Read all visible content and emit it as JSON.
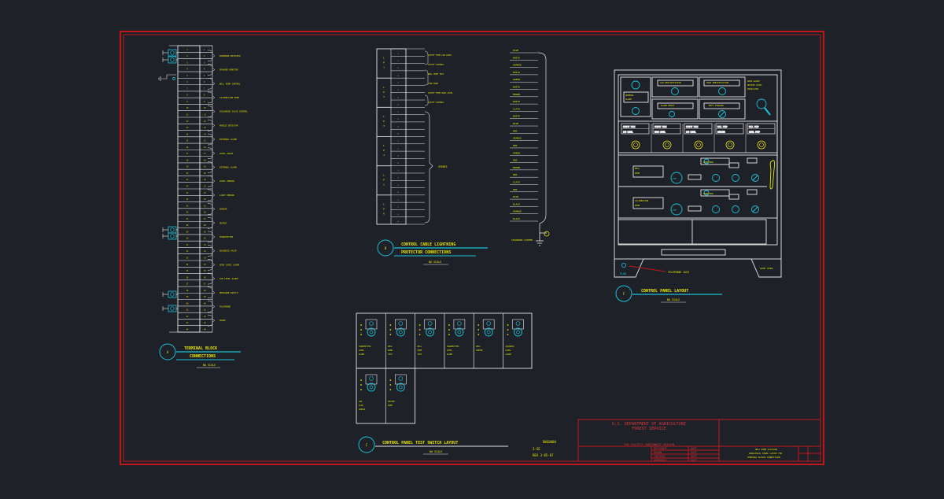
{
  "colors": {
    "background": "#1f2128",
    "border": "#c0161b",
    "linework": "#e8e8e8",
    "text": "#e6e600",
    "accent": "#19c3d8",
    "titleblock_text": "#d23a3a"
  },
  "terminal_block": {
    "circle_label": "A",
    "title": "TERMINAL BLOCK",
    "subtitle": "CONNECTIONS",
    "scale": "NO SCALE",
    "groups": [
      "WIDEBAND RECEIVER",
      "SPEAKER MONITOR",
      "WELL PUMP CONTROL",
      "CALIBRATION PUMP",
      "DISCHARGE VALVE CONTROL",
      "FREEZE DETECTOR",
      "EXTERNAL ALARM",
      "LEVEL GAUGE",
      "EXTERNAL ALARM",
      "LEVEL SENSOR",
      "LIGHT SENSOR",
      "SENSOR",
      "OUTPUT",
      "TRANSMITTER",
      "SOLENOID VALVE",
      "HIGH LEVEL ALARM",
      "LOW LEVEL ALARM",
      "PRESSURE SWITCH",
      "TELEPHONE",
      "SPARE"
    ]
  },
  "control_cable": {
    "circle_label": "B",
    "title": "CONTROL CABLE LIGHTNING",
    "subtitle": "PROTECTOR CONNECTIONS",
    "scale": "NO SCALE",
    "protectors": [
      "LP1",
      "LP2",
      "LP3",
      "LP4",
      "LP5",
      "LP6"
    ],
    "labels": [
      "CUTOFF FROM LOW LEVEL",
      "CUTOFF CONTROL",
      "WELL PUMP TEST",
      "LEAD WIRE",
      "CUTOFF FROM HIGH LEVEL",
      "CUTOFF CONTROL"
    ],
    "spares": "SPARES",
    "wire_colors": [
      "BLUE",
      "WHITE",
      "ORANGE",
      "WHITE",
      "GREEN",
      "WHITE",
      "BROWN",
      "WHITE",
      "SLATE",
      "WHITE",
      "BLUE",
      "RED",
      "ORANGE",
      "RED",
      "GREEN",
      "RED",
      "BROWN",
      "RED",
      "SLATE",
      "RED",
      "BLUE",
      "BLACK",
      "ORANGE",
      "BLACK"
    ],
    "ground_label": "STRANDED COPPER"
  },
  "control_panel": {
    "circle_label": "F",
    "title": "CONTROL PANEL LAYOUT",
    "scale": "NO SCALE",
    "callouts": {
      "phone_jack": "TELEPHONE JACK",
      "plan": "PLAN",
      "side": "SIDE VIEW"
    }
  },
  "switch_layout": {
    "circle_label": "C",
    "title": "CONTROL PANEL TEST SWITCH LAYOUT",
    "scale": "NO SCALE"
  },
  "drawing_info": {
    "number": "DWG0000",
    "sheet": "3-SE",
    "revision": "REV 3-05-87"
  },
  "title_block": {
    "agency_line1": "U.S. DEPARTMENT OF AGRICULTURE",
    "agency_line2": "FOREST SERVICE",
    "region": "THE PACIFIC NORTHWEST REGION",
    "rows": [
      "DESIGNED",
      "DRAWN",
      "CHECKED",
      "APPROVED"
    ]
  }
}
